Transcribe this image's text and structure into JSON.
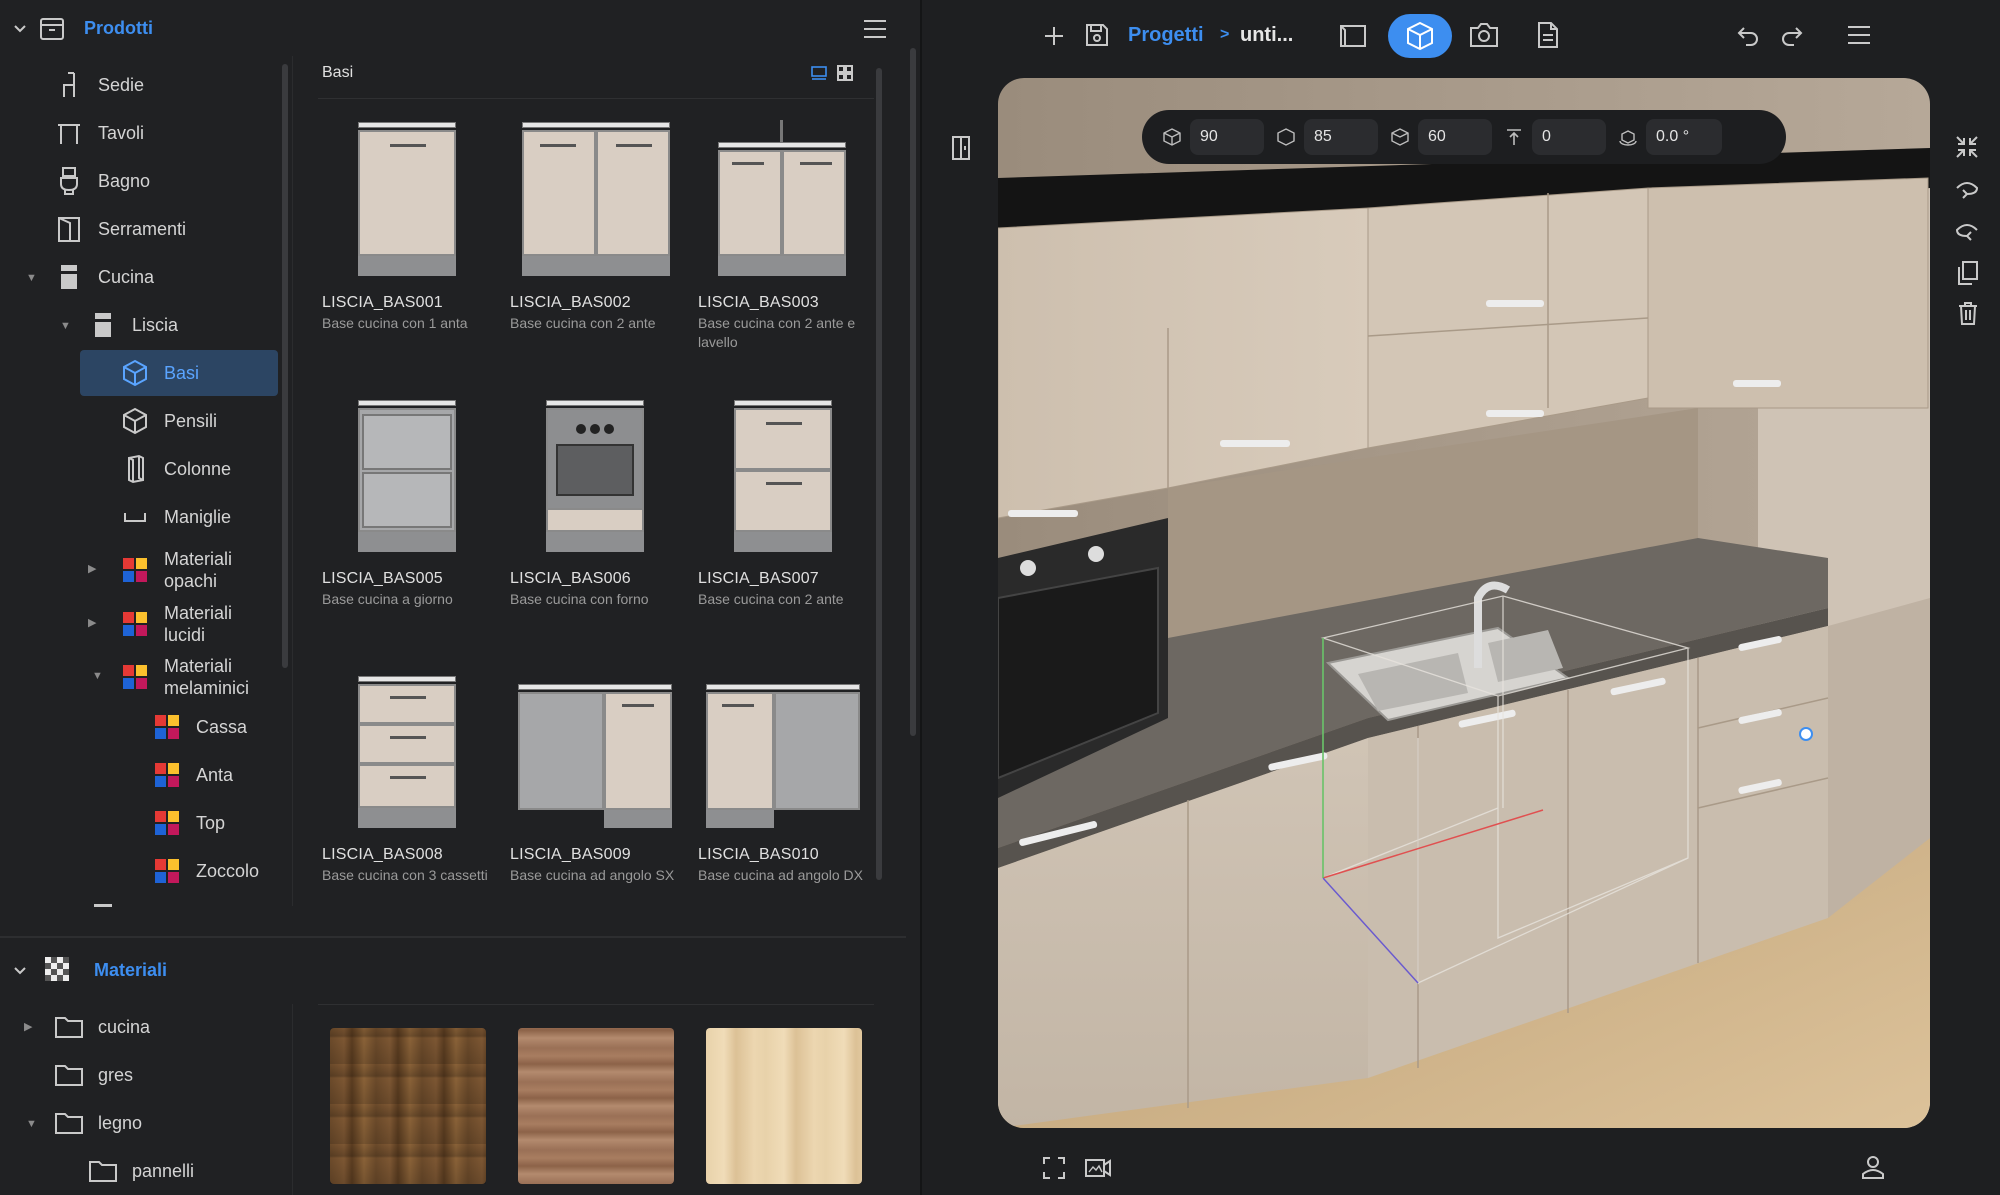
{
  "products_panel": {
    "title": "Prodotti",
    "tree": [
      {
        "label": "Sedie"
      },
      {
        "label": "Tavoli"
      },
      {
        "label": "Bagno"
      },
      {
        "label": "Serramenti"
      },
      {
        "label": "Cucina"
      },
      {
        "label": "Liscia"
      },
      {
        "label": "Basi"
      },
      {
        "label": "Pensili"
      },
      {
        "label": "Colonne"
      },
      {
        "label": "Maniglie"
      },
      {
        "label": "Materiali opachi"
      },
      {
        "label": "Materiali lucidi"
      },
      {
        "label": "Materiali melaminici"
      },
      {
        "label": "Cassa"
      },
      {
        "label": "Anta"
      },
      {
        "label": "Top"
      },
      {
        "label": "Zoccolo"
      }
    ],
    "grid_title": "Basi",
    "items": [
      {
        "name": "LISCIA_BAS001",
        "desc": "Base cucina con 1 anta"
      },
      {
        "name": "LISCIA_BAS002",
        "desc": "Base cucina con 2 ante"
      },
      {
        "name": "LISCIA_BAS003",
        "desc": "Base cucina con 2 ante e lavello"
      },
      {
        "name": "LISCIA_BAS005",
        "desc": "Base cucina a giorno"
      },
      {
        "name": "LISCIA_BAS006",
        "desc": "Base cucina con forno"
      },
      {
        "name": "LISCIA_BAS007",
        "desc": "Base cucina con 2 ante"
      },
      {
        "name": "LISCIA_BAS008",
        "desc": "Base cucina con 3 cassetti"
      },
      {
        "name": "LISCIA_BAS009",
        "desc": "Base cucina ad angolo SX"
      },
      {
        "name": "LISCIA_BAS010",
        "desc": "Base cucina ad angolo DX"
      }
    ]
  },
  "materials_panel": {
    "title": "Materiali",
    "folders": [
      {
        "label": "cucina"
      },
      {
        "label": "gres"
      },
      {
        "label": "legno"
      },
      {
        "label": "pannelli"
      }
    ]
  },
  "toolbar": {
    "breadcrumb_root": "Progetti",
    "breadcrumb_sep": ">",
    "breadcrumb_current": "unti..."
  },
  "dimensions": {
    "width": "90",
    "depth": "85",
    "height": "60",
    "elevation": "0",
    "rotation": "0.0 °"
  },
  "colors": {
    "accent": "#3d8ef0",
    "panel_bg": "#202123",
    "cabinet": "#d9cec3"
  }
}
